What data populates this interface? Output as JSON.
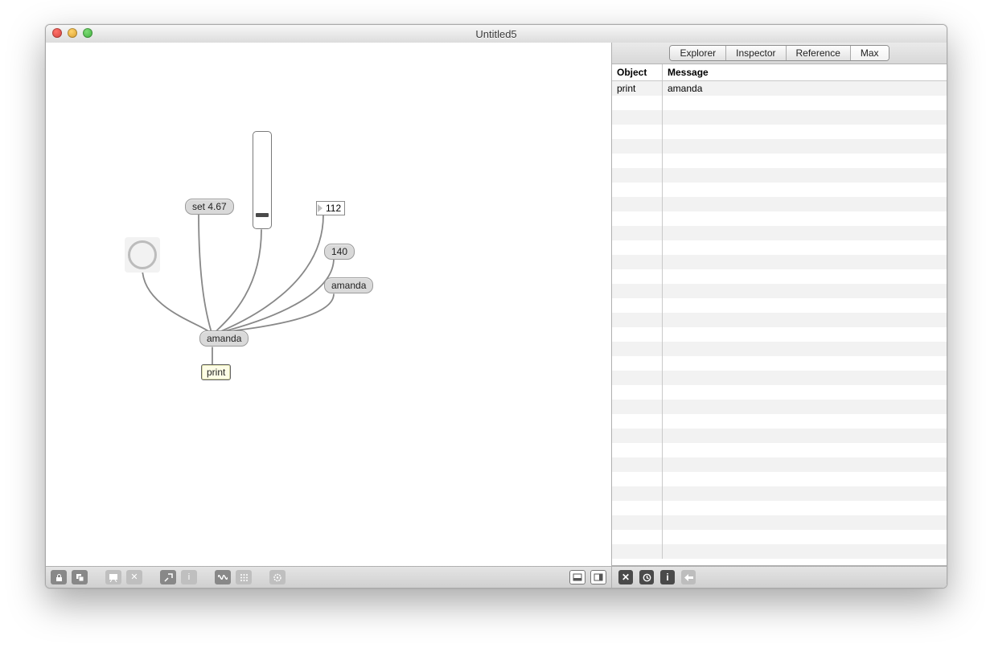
{
  "window": {
    "title": "Untitled5"
  },
  "patch": {
    "set_msg": "set 4.67",
    "numbox1": "112",
    "msg_140": "140",
    "msg_amanda_src": "amanda",
    "msg_amanda_dst": "amanda",
    "obj_print": "print"
  },
  "sidebar": {
    "tabs": {
      "explorer": "Explorer",
      "inspector": "Inspector",
      "reference": "Reference",
      "max": "Max"
    },
    "active_tab": "max",
    "headers": {
      "object": "Object",
      "message": "Message"
    },
    "rows": [
      {
        "object": "print",
        "message": "amanda"
      }
    ]
  }
}
